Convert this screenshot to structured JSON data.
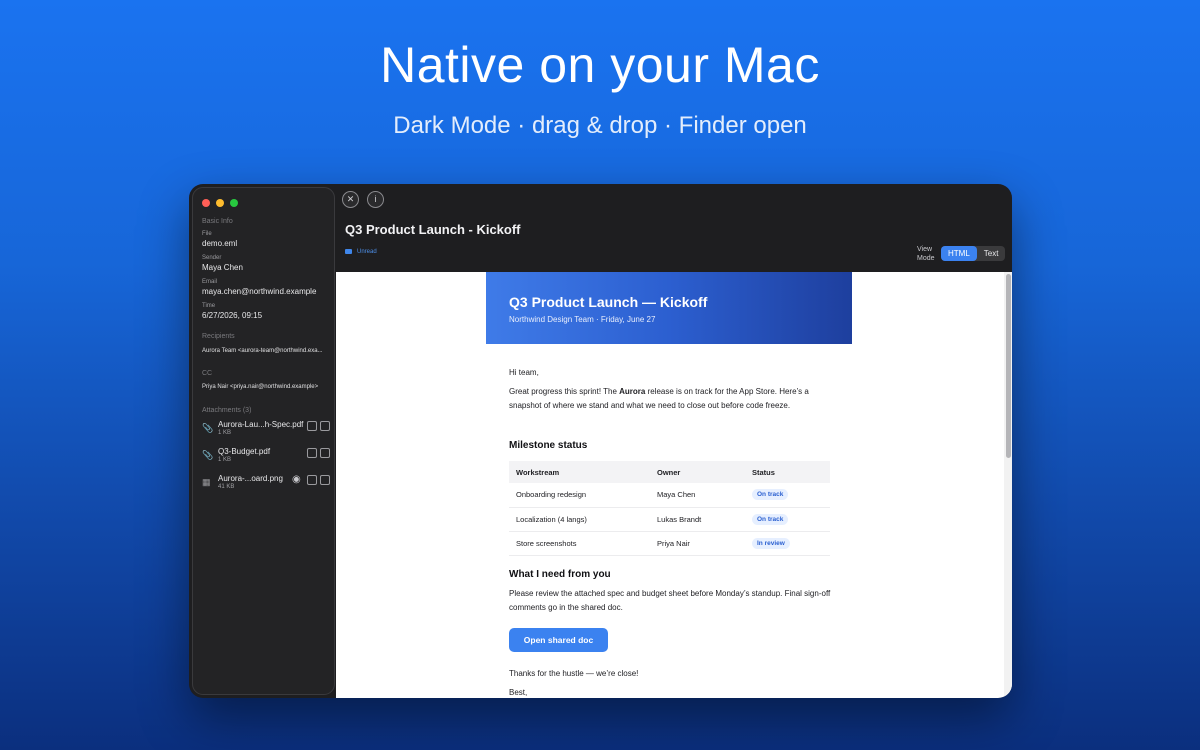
{
  "hero": {
    "title": "Native on your Mac",
    "subtitle": "Dark Mode · drag & drop · Finder open"
  },
  "colors": {
    "accent": "#3b82f0",
    "background_top": "#1a73f0",
    "background_bottom": "#0b2f7e"
  },
  "sidebar": {
    "basic_info_heading": "Basic Info",
    "file_label": "File",
    "file_value": "demo.eml",
    "sender_label": "Sender",
    "sender_value": "Maya Chen",
    "email_label": "Email",
    "email_value": "maya.chen@northwind.example",
    "time_label": "Time",
    "time_value": "6/27/2026, 09:15",
    "recipients_heading": "Recipients",
    "recipients_value": "Aurora Team <aurora-team@northwind.exa...",
    "cc_heading": "CC",
    "cc_value": "Priya Nair <priya.nair@northwind.example>",
    "attachments_heading": "Attachments (3)",
    "attachments": [
      {
        "name": "Aurora-Lau...h-Spec.pdf",
        "size": "1 KB",
        "icon": "paperclip-icon"
      },
      {
        "name": "Q3-Budget.pdf",
        "size": "1 KB",
        "icon": "paperclip-icon"
      },
      {
        "name": "Aurora-...oard.png",
        "size": "41 KB",
        "icon": "image-icon"
      }
    ]
  },
  "toolbar": {
    "close_icon": "close-icon",
    "info_icon": "info-icon"
  },
  "email": {
    "title": "Q3 Product Launch - Kickoff",
    "status": "Unread",
    "view_mode_label": "View Mode",
    "view_modes": [
      "HTML",
      "Text"
    ],
    "active_view_mode": "HTML"
  },
  "message": {
    "banner_title": "Q3 Product Launch — Kickoff",
    "banner_subtitle": "Northwind Design Team · Friday, June 27",
    "greeting": "Hi team,",
    "intro_before": "Great progress this sprint! The ",
    "intro_bold": "Aurora",
    "intro_after": " release is on track for the App Store. Here’s a snapshot of where we stand and what we need to close out before code freeze.",
    "milestone_heading": "Milestone status",
    "table_headers": [
      "Workstream",
      "Owner",
      "Status"
    ],
    "table_rows": [
      {
        "workstream": "Onboarding redesign",
        "owner": "Maya Chen",
        "status": "On track"
      },
      {
        "workstream": "Localization (4 langs)",
        "owner": "Lukas Brandt",
        "status": "On track"
      },
      {
        "workstream": "Store screenshots",
        "owner": "Priya Nair",
        "status": "In review"
      }
    ],
    "need_heading": "What I need from you",
    "need_text": "Please review the attached spec and budget sheet before Monday’s standup. Final sign-off comments go in the shared doc.",
    "cta_label": "Open shared doc",
    "closing": "Thanks for the hustle — we’re close!",
    "signoff": "Best,"
  }
}
